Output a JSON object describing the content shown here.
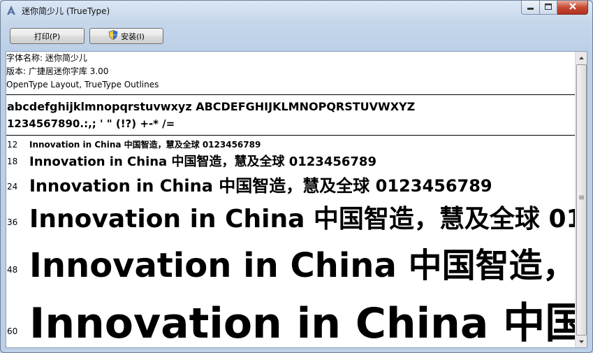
{
  "window": {
    "title": "迷你简少儿 (TrueType)",
    "icon": "font-file-icon"
  },
  "toolbar": {
    "print_label": "打印(P)",
    "install_label": "安装(I)",
    "install_icon": "shield-icon"
  },
  "info": {
    "font_name_line": "字体名称: 迷你简少儿",
    "version_line": "版本: 广捷居迷你字库 3.00",
    "type_line": "OpenType Layout, TrueType Outlines"
  },
  "charset": {
    "line1": "abcdefghijklmnopqrstuvwxyz ABCDEFGHIJKLMNOPQRSTUVWXYZ",
    "line2": "1234567890.:,; ' \" (!?) +-* /="
  },
  "sample_text": "Innovation in China 中国智造，慧及全球 0123456789",
  "samples": [
    {
      "size": "12"
    },
    {
      "size": "18"
    },
    {
      "size": "24"
    },
    {
      "size": "36"
    },
    {
      "size": "48"
    },
    {
      "size": "60"
    }
  ],
  "colors": {
    "frame": "#bcd0e7",
    "close_button": "#c74a32",
    "content_bg": "#ffffff"
  }
}
